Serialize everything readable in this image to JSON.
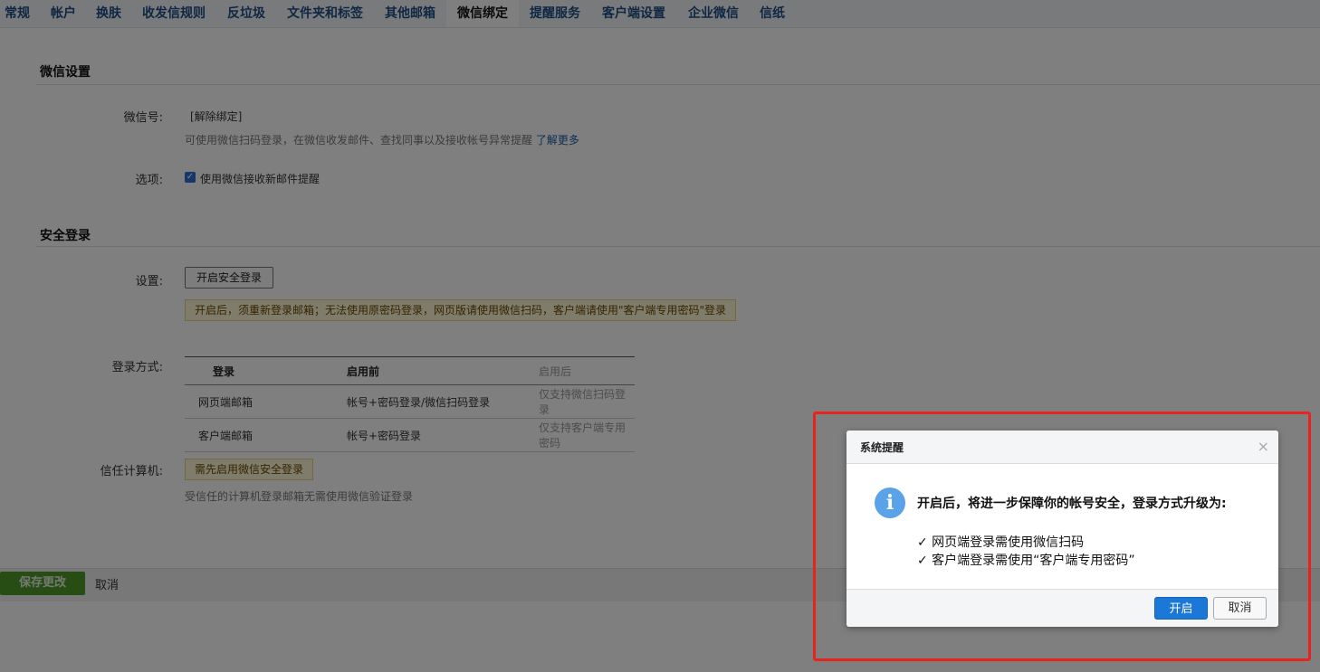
{
  "tabs": [
    "常规",
    "帐户",
    "换肤",
    "收发信规则",
    "反垃圾",
    "文件夹和标签",
    "其他邮箱",
    "微信绑定",
    "提醒服务",
    "客户端设置",
    "企业微信",
    "信纸"
  ],
  "wechat_section": {
    "title": "微信设置",
    "account_label": "微信号:",
    "unbind_link": "[解除绑定]",
    "desc": "可使用微信扫码登录，在微信收发邮件、查找同事以及接收帐号异常提醒",
    "learn_more": "了解更多",
    "options_label": "选项:",
    "option_checkbox": "使用微信接收新邮件提醒"
  },
  "security_section": {
    "title": "安全登录",
    "setting_label": "设置:",
    "enable_button": "开启安全登录",
    "warning": "开启后，须重新登录邮箱；无法使用原密码登录，网页版请使用微信扫码，客户端请使用\"客户端专用密码\"登录",
    "login_method_label": "登录方式:",
    "table": {
      "headers": [
        "登录",
        "启用前",
        "启用后"
      ],
      "rows": [
        [
          "网页端邮箱",
          "帐号+密码登录/微信扫码登录",
          "仅支持微信扫码登录"
        ],
        [
          "客户端邮箱",
          "帐号+密码登录",
          "仅支持客户端专用密码"
        ]
      ]
    },
    "trusted_label": "信任计算机:",
    "trusted_note": "需先启用微信安全登录",
    "trusted_desc": "受信任的计算机登录邮箱无需使用微信验证登录"
  },
  "footer": {
    "save": "保存更改",
    "cancel": "取消"
  },
  "dialog": {
    "title": "系统提醒",
    "close": "×",
    "main": "开启后，将进一步保障你的帐号安全，登录方式升级为:",
    "items": [
      "✓ 网页端登录需使用微信扫码",
      "✓ 客户端登录需使用“客户端专用密码”"
    ],
    "ok": "开启",
    "cancel": "取消"
  },
  "colors": {
    "tab_text": "#1e4f86",
    "primary_button": "#1c78d6",
    "save_button": "#4f9a2b",
    "highlight_border": "#e8231f",
    "warning_bg": "#fff8d9"
  }
}
